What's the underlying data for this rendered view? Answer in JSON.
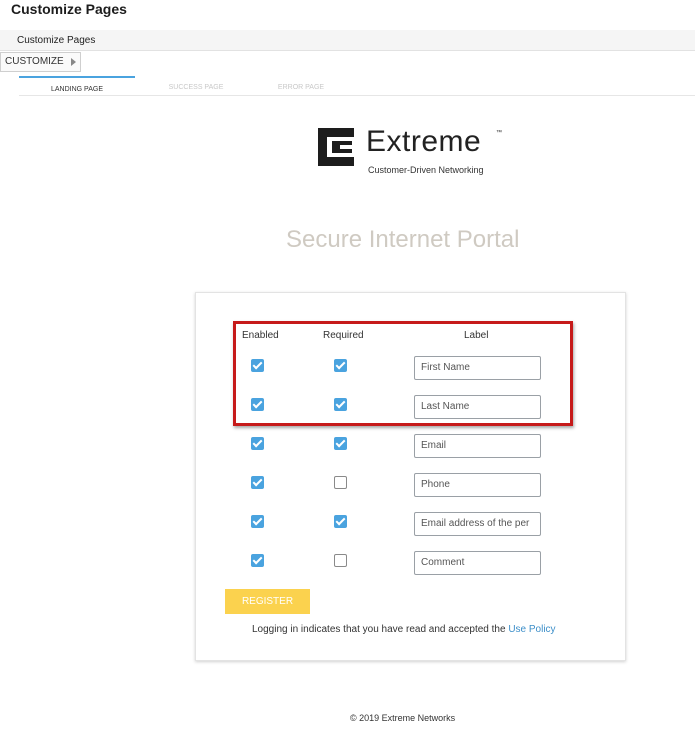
{
  "header": {
    "title": "Customize Pages"
  },
  "subbar": {
    "label": "Customize Pages"
  },
  "breadcrumb": {
    "label": "CUSTOMIZE"
  },
  "tabs": [
    {
      "label": "LANDING PAGE",
      "active": true
    },
    {
      "label": "SUCCESS PAGE",
      "active": false
    },
    {
      "label": "ERROR PAGE",
      "active": false
    }
  ],
  "brand": {
    "name": "Extreme",
    "tm": "™",
    "tagline": "Customer-Driven Networking"
  },
  "portal": {
    "title": "Secure Internet Portal"
  },
  "form": {
    "columns": {
      "enabled": "Enabled",
      "required": "Required",
      "label": "Label"
    },
    "rows": [
      {
        "enabled": true,
        "required": true,
        "label": "First Name"
      },
      {
        "enabled": true,
        "required": true,
        "label": "Last Name"
      },
      {
        "enabled": true,
        "required": true,
        "label": "Email"
      },
      {
        "enabled": true,
        "required": false,
        "label": "Phone"
      },
      {
        "enabled": true,
        "required": true,
        "label": "Email address of the per"
      },
      {
        "enabled": true,
        "required": false,
        "label": "Comment"
      }
    ],
    "register_label": "REGISTER",
    "policy_text": "Logging in indicates that you have read and accepted the",
    "policy_link": "Use Policy"
  },
  "footer": {
    "text": "© 2019 Extreme Networks"
  },
  "colors": {
    "accent": "#4aa3df",
    "highlight": "#c61a1a",
    "register": "#fbd24e",
    "portal_title": "#cfcac2",
    "link": "#3d8fc9"
  }
}
